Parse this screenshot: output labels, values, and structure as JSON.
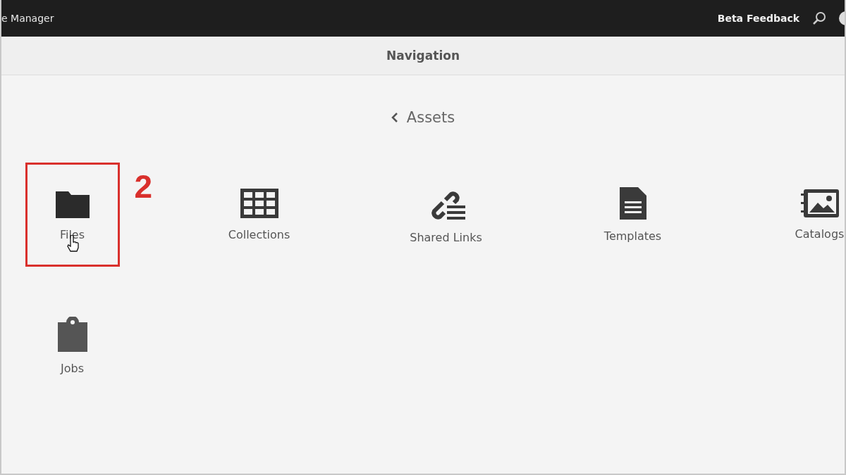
{
  "top_bar": {
    "title": "e Manager",
    "feedback": "Beta Feedback"
  },
  "header": {
    "title": "Navigation"
  },
  "breadcrumb": {
    "label": "Assets"
  },
  "tiles": [
    {
      "kind": "folder",
      "label": "Files",
      "highlighted": true,
      "annotation": "2"
    },
    {
      "kind": "grid",
      "label": "Collections",
      "highlighted": false
    },
    {
      "kind": "link",
      "label": "Shared Links",
      "highlighted": false
    },
    {
      "kind": "document",
      "label": "Templates",
      "highlighted": false
    },
    {
      "kind": "catalog",
      "label": "Catalogs",
      "highlighted": false
    },
    {
      "kind": "clipboard",
      "label": "Jobs",
      "highlighted": false
    }
  ]
}
